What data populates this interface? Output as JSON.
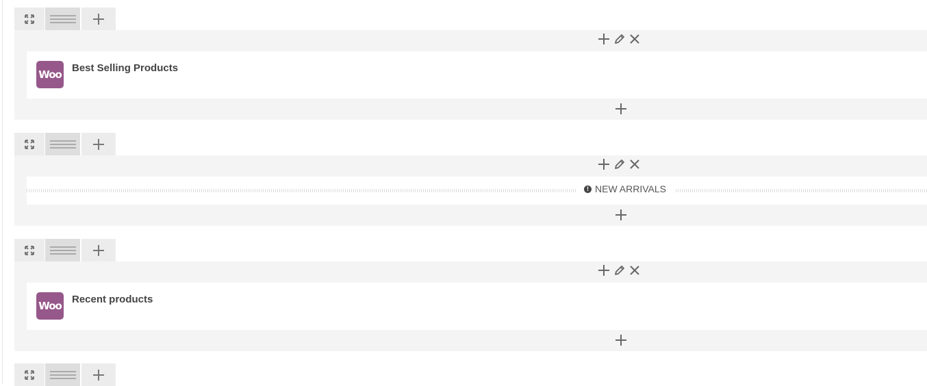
{
  "rows": [
    {
      "kind": "widget",
      "icon": "woo-icon",
      "badge": "Woo",
      "title": "Best Selling Products"
    },
    {
      "kind": "separator",
      "icon": "info-icon",
      "badge": "!",
      "title": "NEW ARRIVALS"
    },
    {
      "kind": "widget",
      "icon": "woo-icon",
      "badge": "Woo",
      "title": "Recent products"
    }
  ],
  "icons": {
    "expand": "expand-icon",
    "drag": "drag-handle-icon",
    "add": "plus-icon",
    "edit": "pencil-icon",
    "delete": "close-icon"
  },
  "colors": {
    "woo_purple": "#96588a",
    "panel_bg": "#f4f4f4",
    "control_bg": "#ececec",
    "icon_gray": "#777777"
  }
}
